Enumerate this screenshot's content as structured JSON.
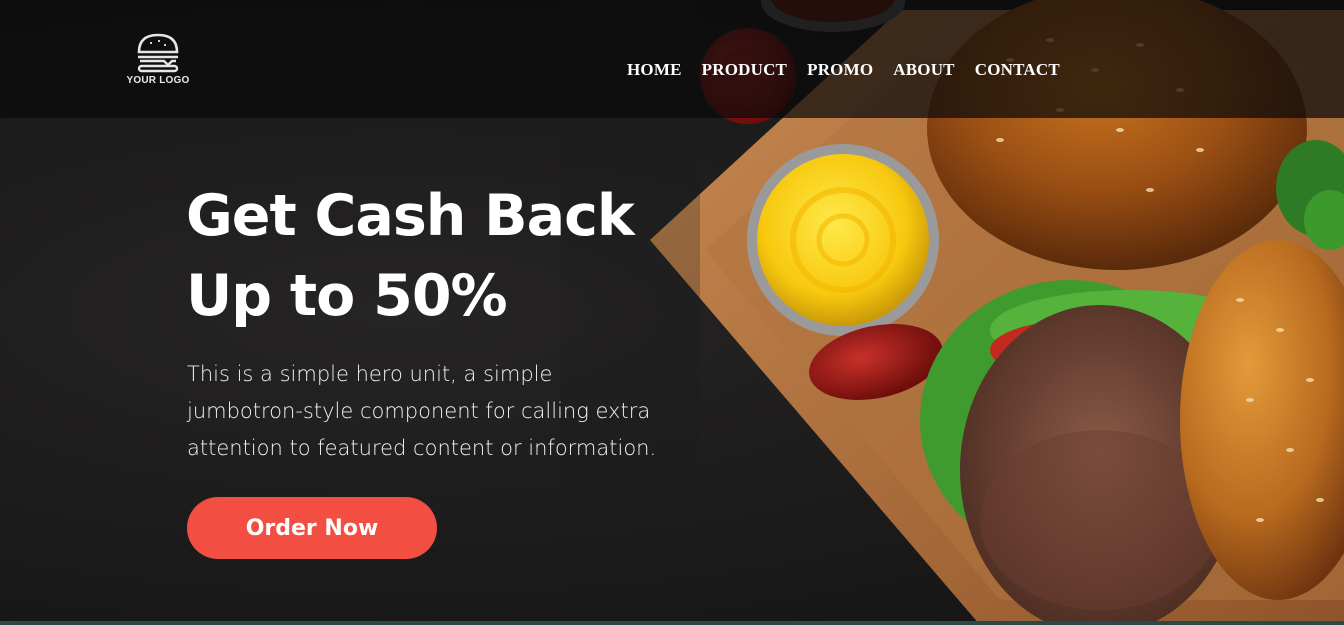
{
  "brand": {
    "logo_text": "YOUR LOGO"
  },
  "nav": {
    "items": [
      {
        "label": "HOME"
      },
      {
        "label": "PRODUCT"
      },
      {
        "label": "PROMO"
      },
      {
        "label": "ABOUT"
      },
      {
        "label": "CONTACT"
      }
    ]
  },
  "hero": {
    "headline_line1": "Get Cash Back",
    "headline_line2": "Up to 50%",
    "lead": "This is a simple hero unit, a simple jumbotron-style component for calling extra attention to featured content or information.",
    "cta_label": "Order Now"
  },
  "colors": {
    "accent": "#f24e42",
    "navbar": "#0a0a0a",
    "background": "#1c1b1b"
  }
}
